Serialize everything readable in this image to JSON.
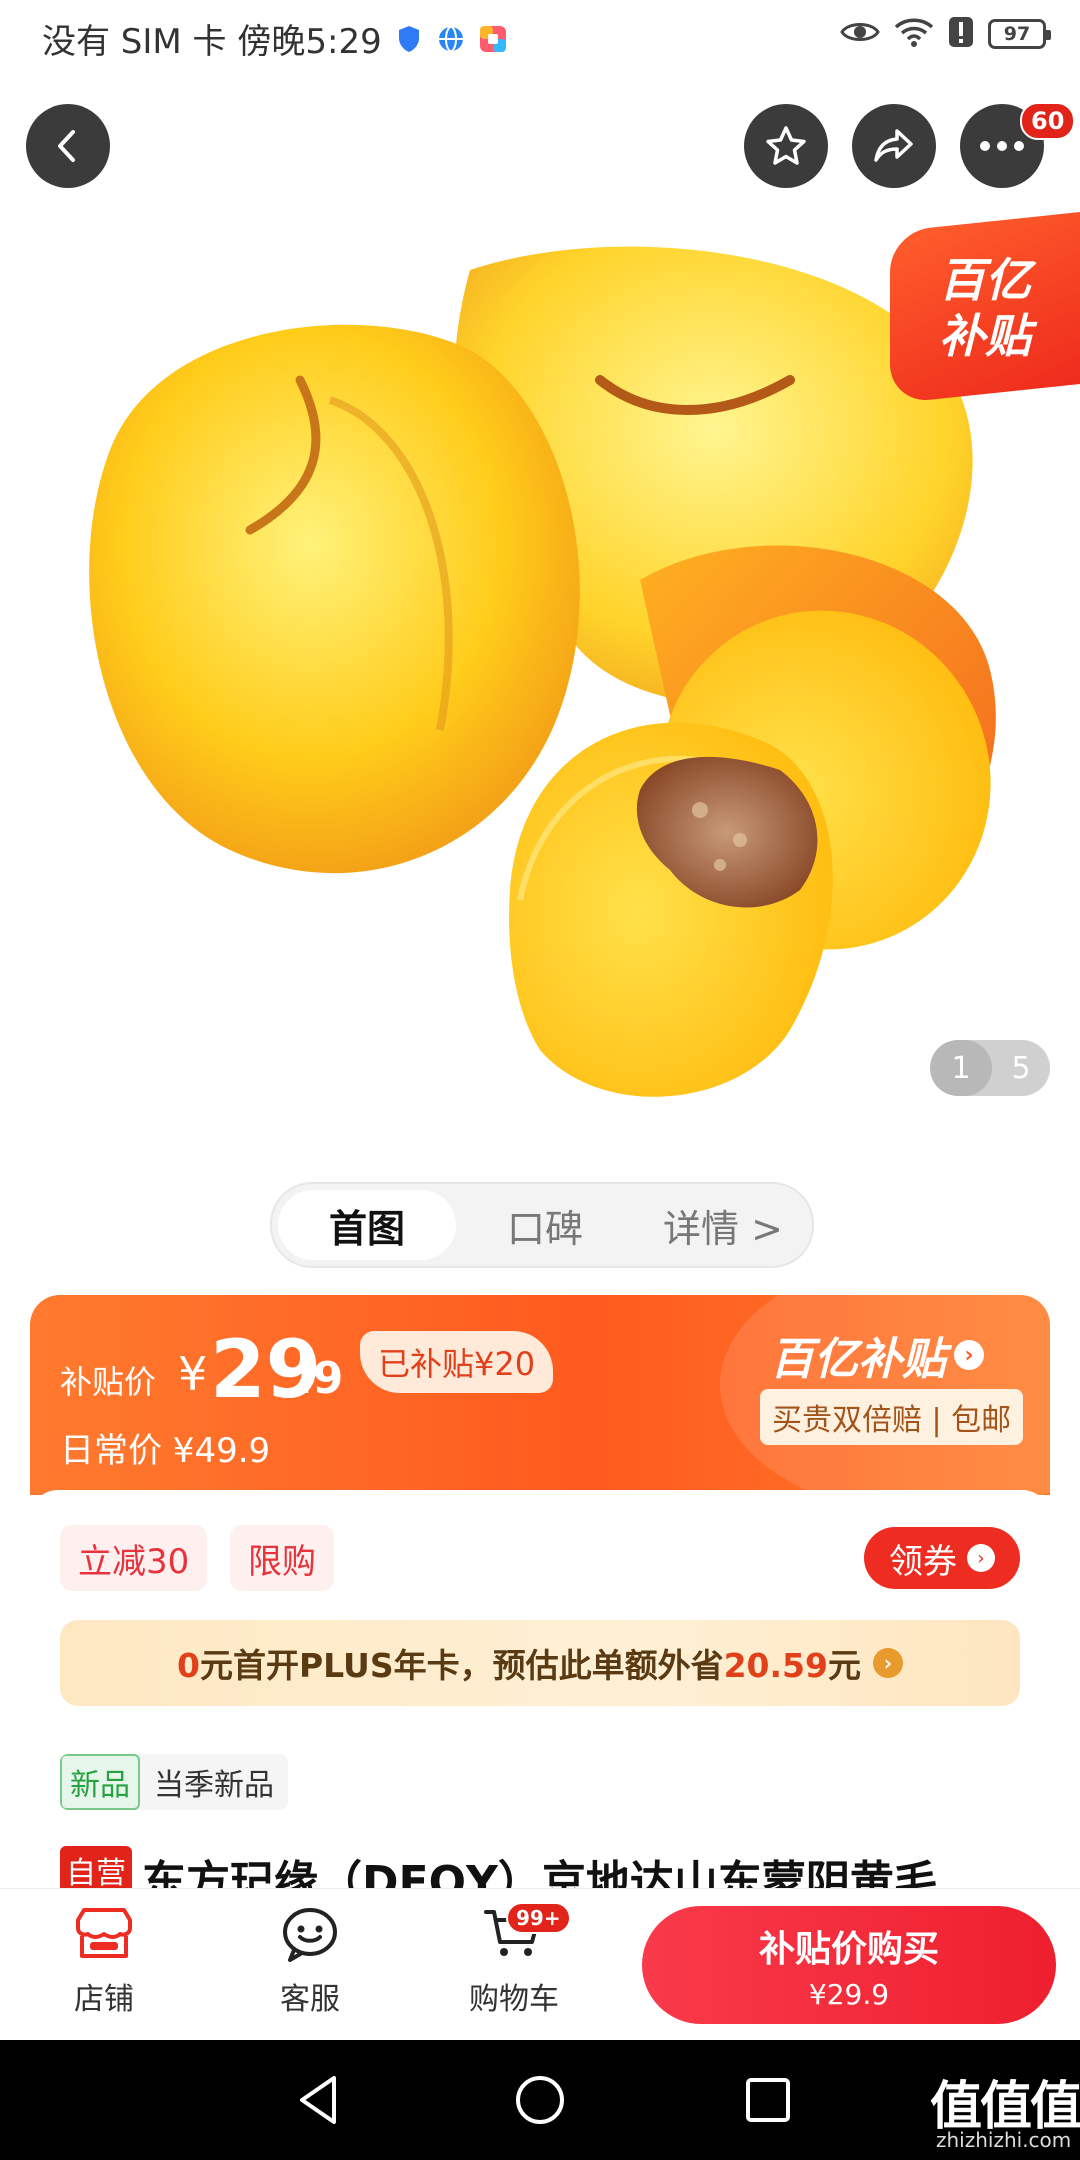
{
  "status_bar": {
    "left_text": "没有 SIM 卡 傍晚5:29",
    "battery": "97"
  },
  "top_nav": {
    "more_badge": "60"
  },
  "hero": {
    "badge_line1": "百亿",
    "badge_line2": "补贴",
    "page_current": "1",
    "page_total": "5"
  },
  "tabs": [
    "首图",
    "口碑",
    "详情 >"
  ],
  "price": {
    "label": "补贴价",
    "currency": "¥",
    "integer": "29",
    "decimal": ".9",
    "subsidized": "已补贴¥20",
    "regular": "日常价 ¥49.9",
    "bybt_logo": "百亿补贴",
    "bybt_promise": "买贵双倍赔 | 包邮"
  },
  "promo": {
    "chip_discount": "立减30",
    "chip_limit": "限购",
    "coupon": "领券",
    "plus_prefix": "0",
    "plus_middle": "元首开PLUS年卡，预估此单额外省",
    "plus_amount": "20.59",
    "plus_suffix": "元"
  },
  "product": {
    "new_tag": "新品",
    "new_tag_text": "当季新品",
    "self_operated": "自营",
    "title": "东方玘缘（DFQY）京地达山东蒙阴黄毛"
  },
  "bottom_bar": {
    "store": "店铺",
    "service": "客服",
    "cart": "购物车",
    "cart_badge": "99+",
    "buy_line1": "补贴价购买",
    "buy_line2": "¥29.9"
  },
  "watermark": {
    "text": "值值值",
    "sub": "zhizhizhi.com"
  }
}
